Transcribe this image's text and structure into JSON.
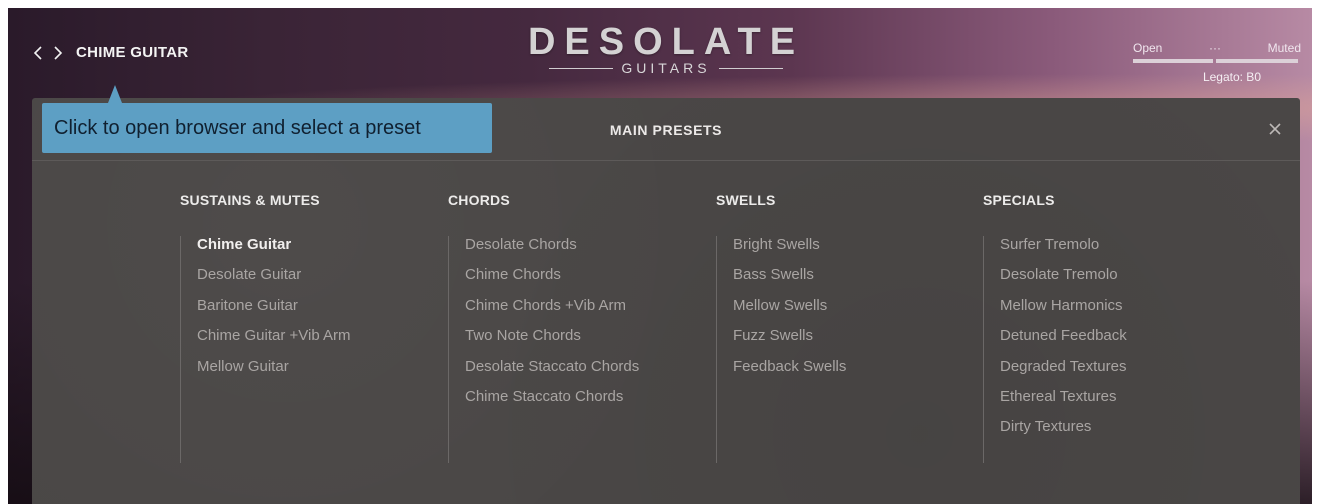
{
  "header": {
    "preset_name": "CHIME GUITAR",
    "logo_title": "DESOLATE",
    "logo_subtitle": "GUITARS",
    "articulation": {
      "open_label": "Open",
      "middle_label": "···",
      "muted_label": "Muted",
      "legato_label": "Legato: B0"
    }
  },
  "tooltip": {
    "text": "Click to open browser and select a preset"
  },
  "panel": {
    "title": "MAIN PRESETS",
    "columns": [
      {
        "heading": "SUSTAINS & MUTES",
        "items": [
          "Chime Guitar",
          "Desolate Guitar",
          "Baritone Guitar",
          "Chime Guitar +Vib Arm",
          "Mellow Guitar"
        ],
        "selected": "Chime Guitar"
      },
      {
        "heading": "CHORDS",
        "items": [
          "Desolate Chords",
          "Chime Chords",
          "Chime Chords +Vib Arm",
          "Two Note Chords",
          "Desolate Staccato Chords",
          "Chime Staccato Chords"
        ]
      },
      {
        "heading": "SWELLS",
        "items": [
          "Bright Swells",
          "Bass Swells",
          "Mellow Swells",
          "Fuzz Swells",
          "Feedback Swells"
        ]
      },
      {
        "heading": "SPECIALS",
        "items": [
          "Surfer Tremolo",
          "Desolate Tremolo",
          "Mellow Harmonics",
          "Detuned Feedback",
          "Degraded Textures",
          "Ethereal Textures",
          "Dirty Textures"
        ]
      }
    ]
  },
  "colors": {
    "tooltip_bg": "#5d9fc4",
    "panel_bg": "#4a4746",
    "selected_item": "#f1efee",
    "item": "#a9a5a3"
  },
  "icons": {
    "prev": "chevron-left-icon",
    "next": "chevron-right-icon",
    "close": "close-icon"
  }
}
